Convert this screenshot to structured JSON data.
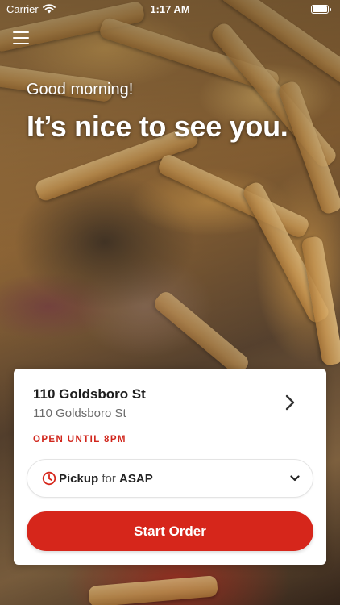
{
  "status_bar": {
    "carrier": "Carrier",
    "time": "1:17 AM"
  },
  "header": {
    "menu_icon": "hamburger-menu-icon"
  },
  "greeting": {
    "subtitle": "Good morning!",
    "headline": "It’s nice to see you."
  },
  "location_card": {
    "name": "110 Goldsboro St",
    "address": "110 Goldsboro St",
    "status": "OPEN UNTIL 8PM",
    "status_color": "#d1261c"
  },
  "order_options": {
    "mode": "Pickup",
    "connector": "for",
    "time": "ASAP"
  },
  "actions": {
    "start_order_label": "Start Order"
  },
  "colors": {
    "accent": "#d6261b",
    "card_background": "#ffffff"
  }
}
